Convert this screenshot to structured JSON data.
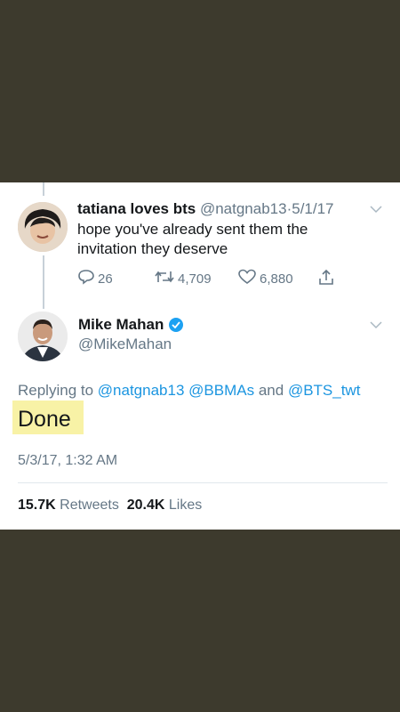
{
  "tweet1": {
    "name": "tatiana loves bts",
    "handle": "@natgnab13",
    "separator": "·",
    "date": "5/1/17",
    "text": "hope you've already sent them the invitation they deserve",
    "replies": "26",
    "retweets": "4,709",
    "likes": "6,880"
  },
  "tweet2": {
    "name": "Mike Mahan",
    "handle": "@MikeMahan",
    "replying_prefix": "Replying to",
    "mention1": "@natgnab13",
    "mention2": "@BBMAs",
    "and_word": "and",
    "mention3": "@BTS_twt",
    "text": "Done",
    "timestamp": "5/3/17, 1:32 AM",
    "retweet_count": "15.7K",
    "retweet_label": "Retweets",
    "like_count": "20.4K",
    "like_label": "Likes"
  },
  "icons": [
    "reply-icon",
    "retweet-icon",
    "like-icon",
    "share-icon",
    "chevron-down-icon",
    "verified-badge-icon"
  ],
  "colors": {
    "background": "#3d3a2d",
    "link": "#1b95e0",
    "verified": "#1da1f2",
    "highlight": "#f8f2a6",
    "secondary_text": "#657786"
  }
}
